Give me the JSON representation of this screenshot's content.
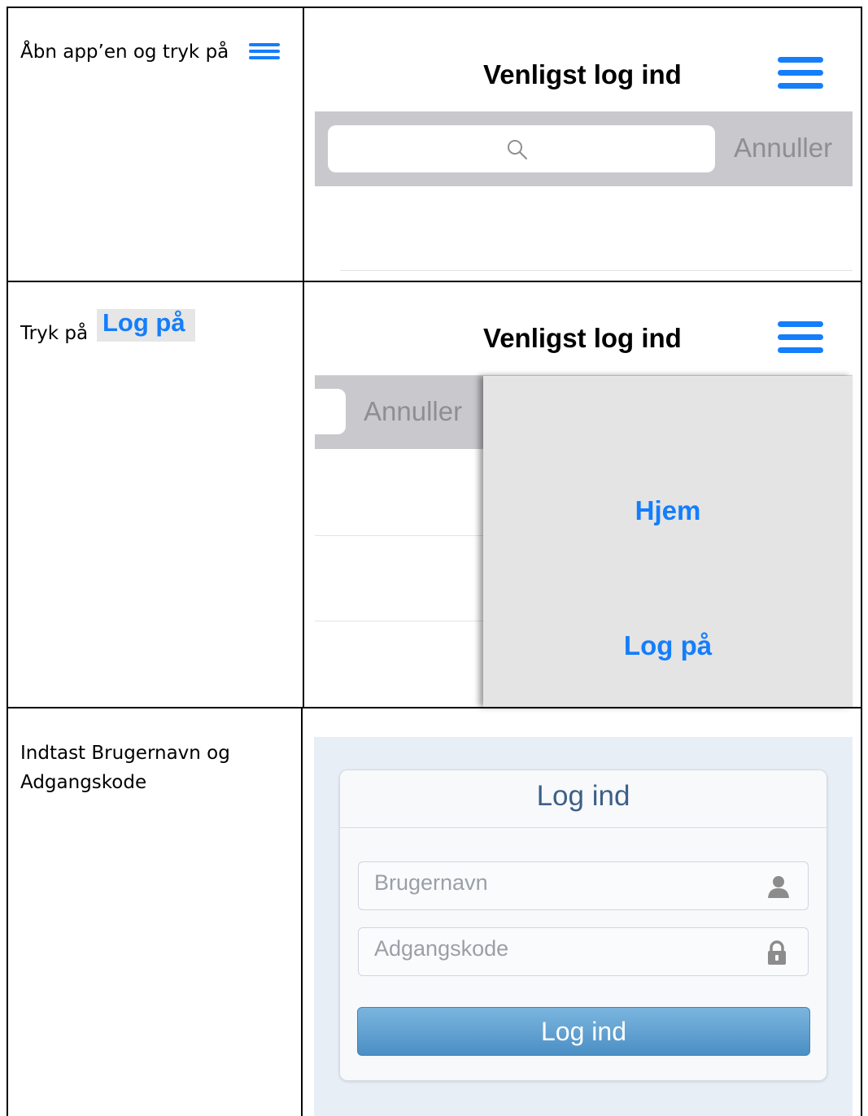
{
  "rows": [
    {
      "instruction": "Åbn app’en og tryk på",
      "screen": {
        "title": "Venligst log ind",
        "search": {
          "cancel_label": "Annuller"
        }
      }
    },
    {
      "instruction": "Tryk på",
      "highlight_label": "Log på",
      "screen": {
        "title": "Venligst log ind",
        "search": {
          "cancel_label": "Annuller"
        },
        "menu": {
          "items": [
            {
              "label": "Hjem"
            },
            {
              "label": "Log på"
            }
          ]
        }
      }
    },
    {
      "instruction": "Indtast Brugernavn og Adgangskode",
      "screen": {
        "card_title": "Log ind",
        "username_placeholder": "Brugernavn",
        "password_placeholder": "Adgangskode",
        "submit_label": "Log ind"
      }
    }
  ],
  "colors": {
    "accent": "#147efb",
    "card_title": "#3e5f86",
    "button": "#5b9ccf"
  },
  "icons": [
    "hamburger-menu-icon",
    "search-icon",
    "user-icon",
    "lock-icon"
  ]
}
